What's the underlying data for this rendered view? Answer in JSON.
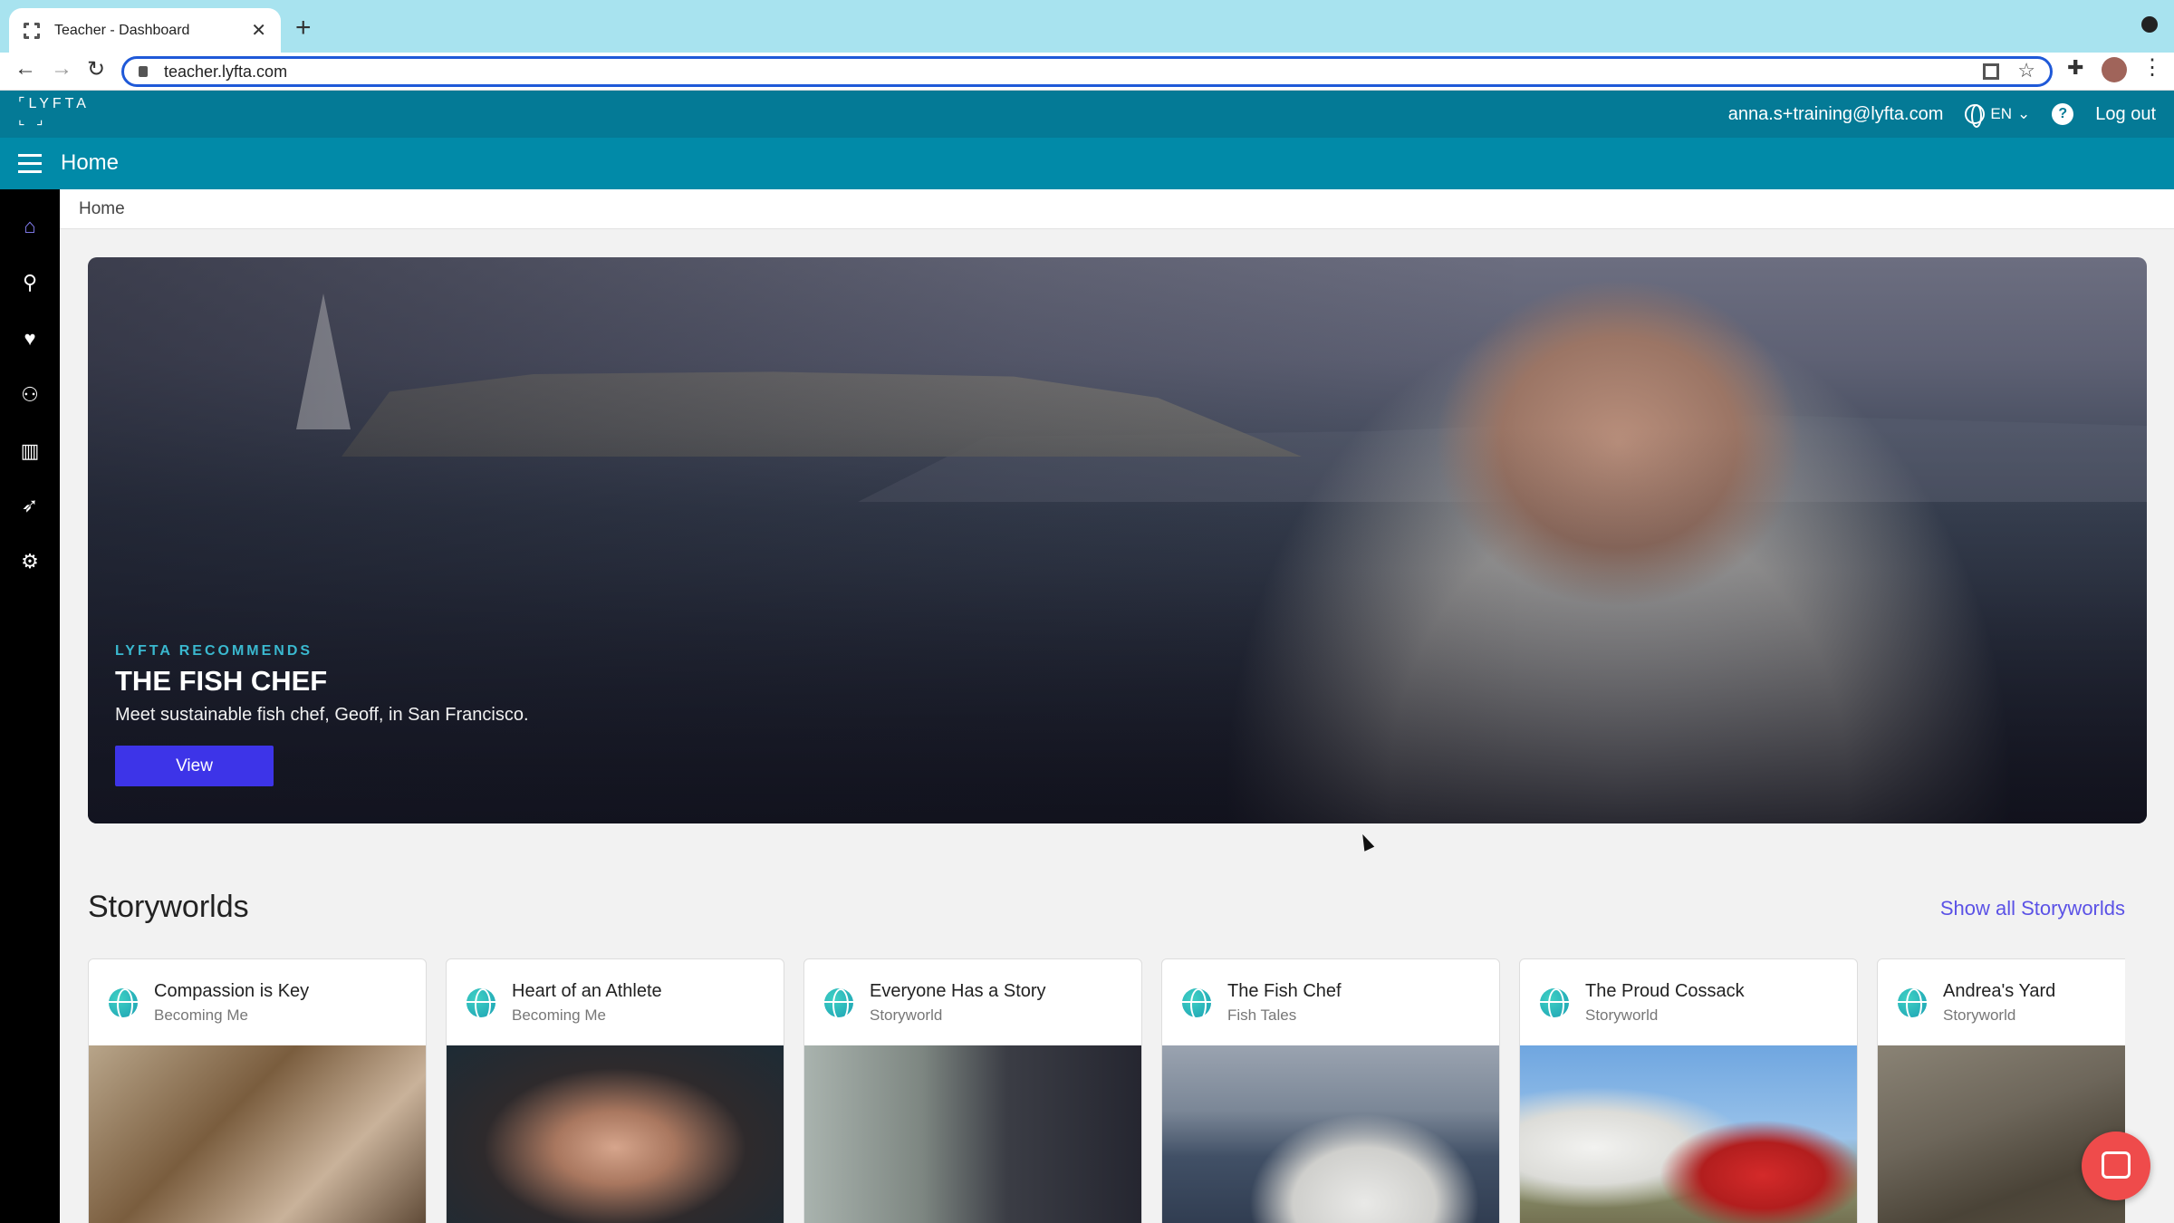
{
  "browser": {
    "tab_title": "Teacher - Dashboard",
    "url": "teacher.lyfta.com"
  },
  "app": {
    "logo": "LYFTA",
    "user_email": "anna.s+training@lyfta.com",
    "language": "EN",
    "logout_label": "Log out",
    "page_title": "Home",
    "breadcrumb": "Home"
  },
  "sidebar": {
    "icons": [
      "home-icon",
      "search-icon",
      "heart-icon",
      "users-icon",
      "book-icon",
      "rocket-icon",
      "settings-screen-icon"
    ]
  },
  "hero": {
    "eyebrow": "LYFTA RECOMMENDS",
    "title": "THE FISH CHEF",
    "description": "Meet sustainable fish chef, Geoff, in San Francisco.",
    "button_label": "View"
  },
  "storyworlds": {
    "heading": "Storyworlds",
    "show_all_label": "Show all Storyworlds",
    "cards": [
      {
        "title": "Compassion is Key",
        "subtitle": "Becoming Me"
      },
      {
        "title": "Heart of an Athlete",
        "subtitle": "Becoming Me"
      },
      {
        "title": "Everyone Has a Story",
        "subtitle": "Storyworld"
      },
      {
        "title": "The Fish Chef",
        "subtitle": "Fish Tales"
      },
      {
        "title": "The Proud Cossack",
        "subtitle": "Storyworld"
      },
      {
        "title": "Andrea's Yard",
        "subtitle": "Storyworld"
      }
    ]
  },
  "colors": {
    "header": "#047a96",
    "subheader": "#018aa8",
    "accent_button": "#3d34e8",
    "link": "#5b52e6",
    "eyebrow": "#3ab8cf"
  }
}
